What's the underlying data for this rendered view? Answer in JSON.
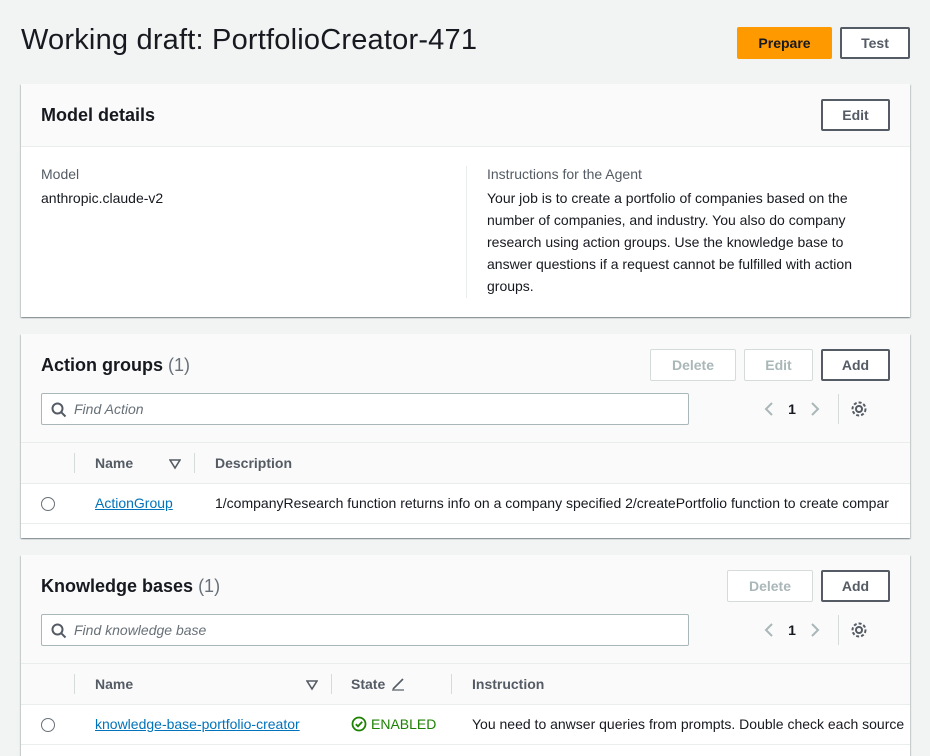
{
  "page": {
    "title": "Working draft: PortfolioCreator-471",
    "prepare_label": "Prepare",
    "test_label": "Test"
  },
  "model_details": {
    "title": "Model details",
    "edit_label": "Edit",
    "model_label": "Model",
    "model_value": "anthropic.claude-v2",
    "instructions_label": "Instructions for the Agent",
    "instructions_value": "Your job is to create a portfolio of companies based on the number of companies, and industry. You also do company research using action groups. Use the knowledge base to answer questions if a request cannot be fulfilled with action groups."
  },
  "action_groups": {
    "title": "Action groups",
    "count": "(1)",
    "delete_label": "Delete",
    "edit_label": "Edit",
    "add_label": "Add",
    "search_placeholder": "Find Action",
    "page_number": "1",
    "columns": [
      "Name",
      "Description"
    ],
    "rows": [
      {
        "name": "ActionGroup",
        "description": "1/companyResearch function returns info on a company specified 2/createPortfolio function to create compar"
      }
    ]
  },
  "knowledge_bases": {
    "title": "Knowledge bases",
    "count": "(1)",
    "delete_label": "Delete",
    "add_label": "Add",
    "search_placeholder": "Find knowledge base",
    "page_number": "1",
    "columns": [
      "Name",
      "State",
      "Instruction"
    ],
    "rows": [
      {
        "name": "knowledge-base-portfolio-creator",
        "state": "ENABLED",
        "instruction": "You need to anwser queries from prompts. Double check each source"
      }
    ]
  },
  "colors": {
    "primary": "#ff9900",
    "link": "#0073bb",
    "success": "#1d8102"
  }
}
